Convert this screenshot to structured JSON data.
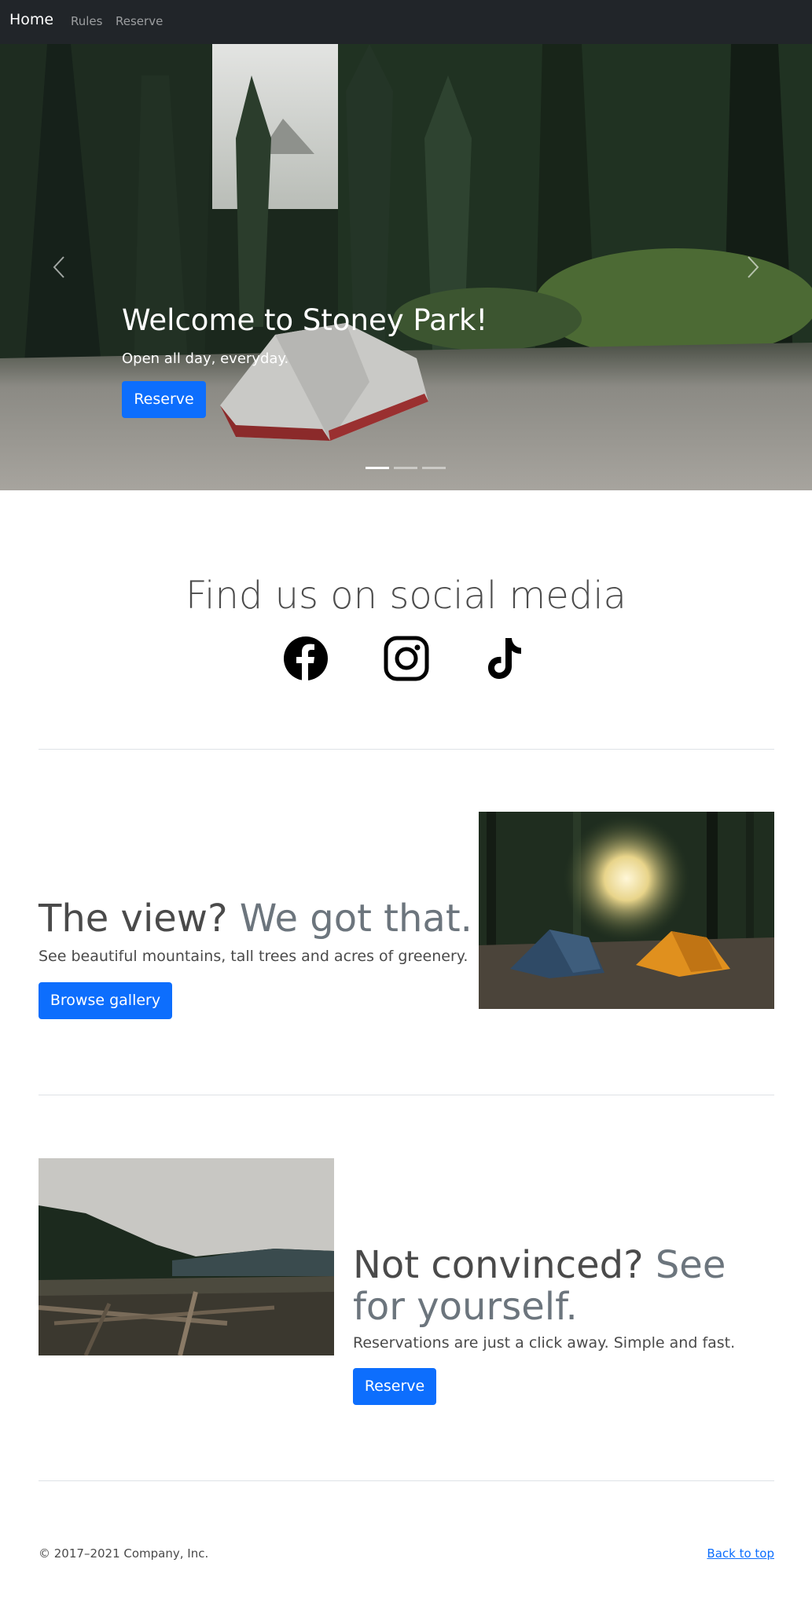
{
  "navbar": {
    "brand": "Home",
    "links": [
      "Rules",
      "Reserve"
    ]
  },
  "hero": {
    "title": "Welcome to Stoney Park!",
    "subtitle": "Open all day, everyday.",
    "button_label": "Reserve",
    "slides_total": 3,
    "active_slide": 1,
    "prev_icon": "chevron-left-icon",
    "next_icon": "chevron-right-icon"
  },
  "social": {
    "heading": "Find us on social media",
    "icons": [
      "facebook-icon",
      "instagram-icon",
      "tiktok-icon"
    ]
  },
  "feature_view": {
    "heading": "The view?",
    "heading_muted": "We got that.",
    "lead": "See beautiful mountains, tall trees and acres of greenery.",
    "button_label": "Browse gallery"
  },
  "feature_convinced": {
    "heading": "Not convinced?",
    "heading_muted": "See for yourself.",
    "lead": "Reservations are just a click away. Simple and fast.",
    "button_label": "Reserve"
  },
  "footer": {
    "copyright": "© 2017–2021 Company, Inc.",
    "back_to_top": "Back to top"
  },
  "colors": {
    "navbar_bg": "#212529",
    "primary": "#0d6efd",
    "muted": "#6c757d",
    "text": "#4a4a4a"
  }
}
